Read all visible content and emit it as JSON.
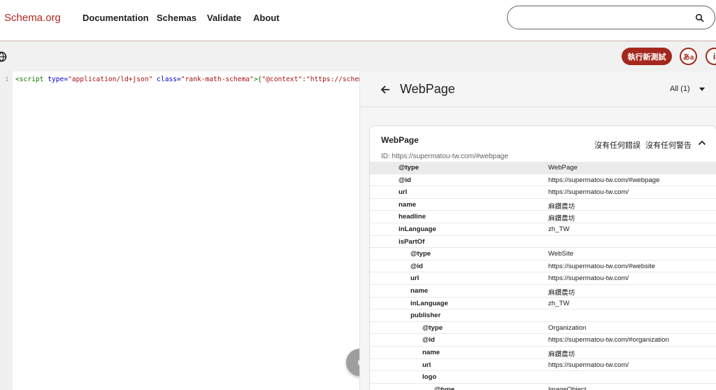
{
  "nav": {
    "brand": "Schema.org",
    "links": [
      "Documentation",
      "Schemas",
      "Validate",
      "About"
    ],
    "search": {
      "value": "",
      "placeholder": ""
    }
  },
  "toolbar": {
    "run_label": "執行新測試",
    "lang_label": "あa",
    "info_label": "i"
  },
  "editor": {
    "line_number": "1",
    "code": {
      "p1": "<script ",
      "a1": "type=",
      "s1": "\"application/ld+json\"",
      "a2": " class=",
      "s2": "\"rank-math-schema\"",
      "p2": ">{",
      "s3": "\"@context\"",
      "p3": ":",
      "s4": "\"https://schema.or"
    }
  },
  "results": {
    "title": "WebPage",
    "filter": "All (1)",
    "card": {
      "title": "WebPage",
      "errors": "沒有任何錯誤",
      "warnings": "沒有任何警告",
      "id": "ID: https://supermatou-tw.com/#webpage",
      "rows": [
        {
          "prop": "@type",
          "val": "WebPage",
          "level": 0
        },
        {
          "prop": "@id",
          "val": "https://supermatou-tw.com/#webpage",
          "level": 0
        },
        {
          "prop": "url",
          "val": "https://supermatou-tw.com/",
          "level": 0
        },
        {
          "prop": "name",
          "val": "麻鑽農坊",
          "level": 0
        },
        {
          "prop": "headline",
          "val": "麻鑽農坊",
          "level": 0
        },
        {
          "prop": "inLanguage",
          "val": "zh_TW",
          "level": 0
        },
        {
          "prop": "isPartOf",
          "val": "",
          "level": 0
        },
        {
          "prop": "@type",
          "val": "WebSite",
          "level": 1
        },
        {
          "prop": "@id",
          "val": "https://supermatou-tw.com/#website",
          "level": 1
        },
        {
          "prop": "url",
          "val": "https://supermatou-tw.com/",
          "level": 1
        },
        {
          "prop": "name",
          "val": "麻鑽農坊",
          "level": 1
        },
        {
          "prop": "inLanguage",
          "val": "zh_TW",
          "level": 1
        },
        {
          "prop": "publisher",
          "val": "",
          "level": 1
        },
        {
          "prop": "@type",
          "val": "Organization",
          "level": 2
        },
        {
          "prop": "@id",
          "val": "https://supermatou-tw.com/#organization",
          "level": 2
        },
        {
          "prop": "name",
          "val": "麻鑽農坊",
          "level": 2
        },
        {
          "prop": "url",
          "val": "https://supermatou-tw.com/",
          "level": 2
        },
        {
          "prop": "logo",
          "val": "",
          "level": 2
        },
        {
          "prop": "@type",
          "val": "ImageObject",
          "level": 3
        }
      ]
    }
  },
  "colors": {
    "brand": "#b3261e",
    "accent": "#a3271d"
  },
  "icons": [
    "search-icon",
    "globe-icon",
    "back-arrow-icon",
    "chevron-down-icon",
    "chevron-up-icon",
    "play-icon"
  ]
}
